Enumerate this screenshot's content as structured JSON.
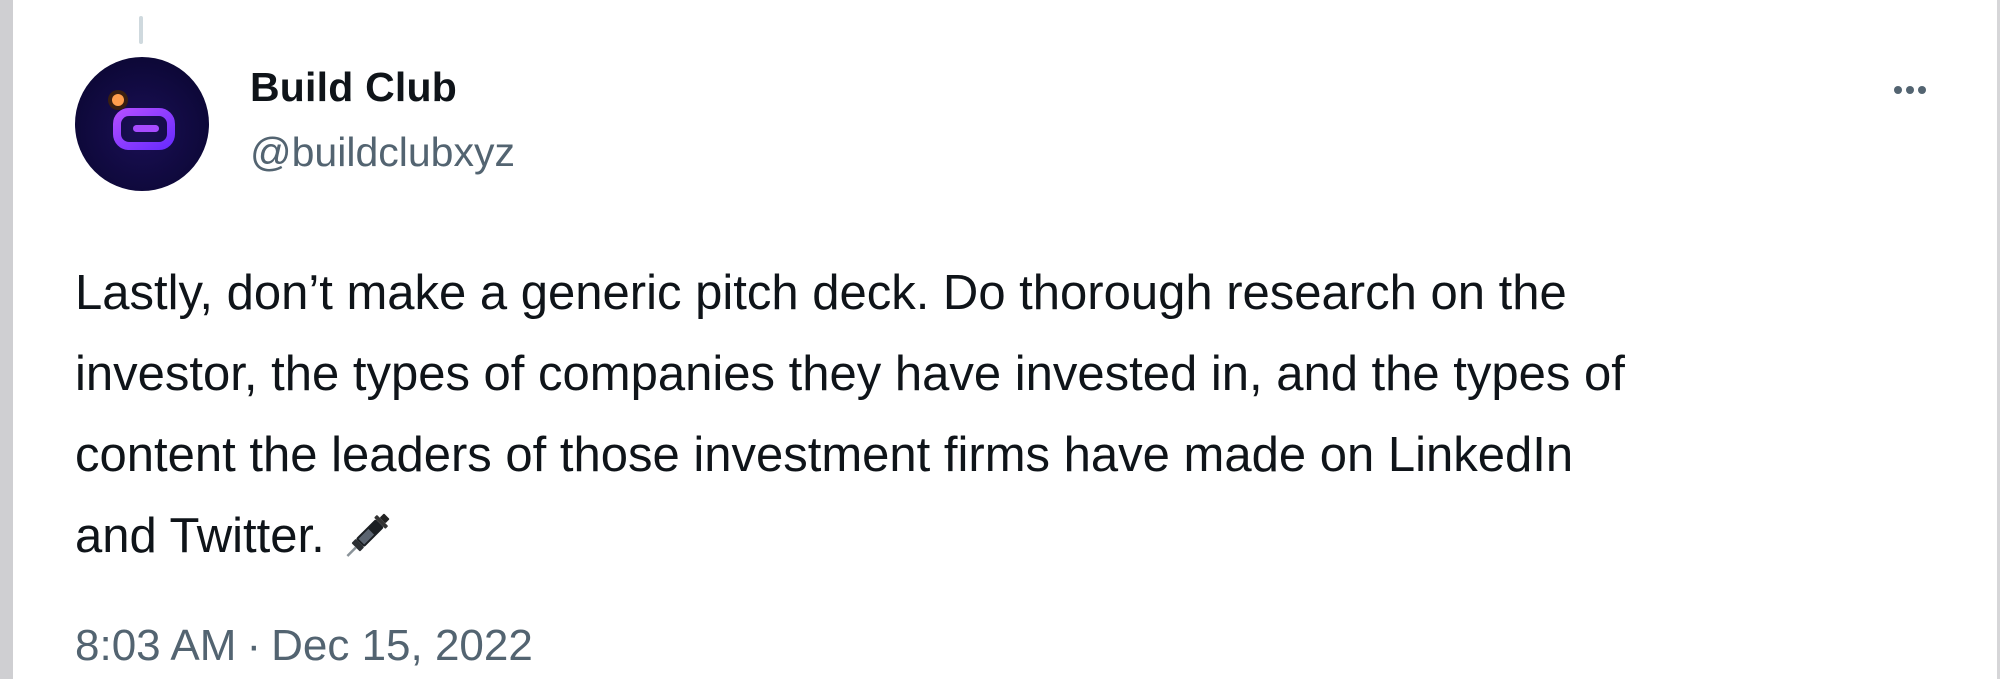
{
  "tweet": {
    "author_name": "Build Club",
    "author_handle": "@buildclubxyz",
    "avatar_icon": "build-club-logo",
    "more_icon": "more-horizontal-icon",
    "text_lines": [
      "Lastly, don’t make a generic pitch deck. Do thorough research on the",
      "investor, the types of companies they have invested in, and the types of",
      "content the leaders of those investment firms have made on LinkedIn",
      "and Twitter."
    ],
    "emoji": "syringe-emoji",
    "time": "8:03 AM",
    "date_separator": "·",
    "date": "Dec 15, 2022"
  },
  "colors": {
    "text_primary": "#0f1419",
    "text_secondary": "#536471",
    "avatar_bg": "#0d0838",
    "logo_purple": "#8b3dff",
    "logo_orange": "#ff9d4d"
  }
}
